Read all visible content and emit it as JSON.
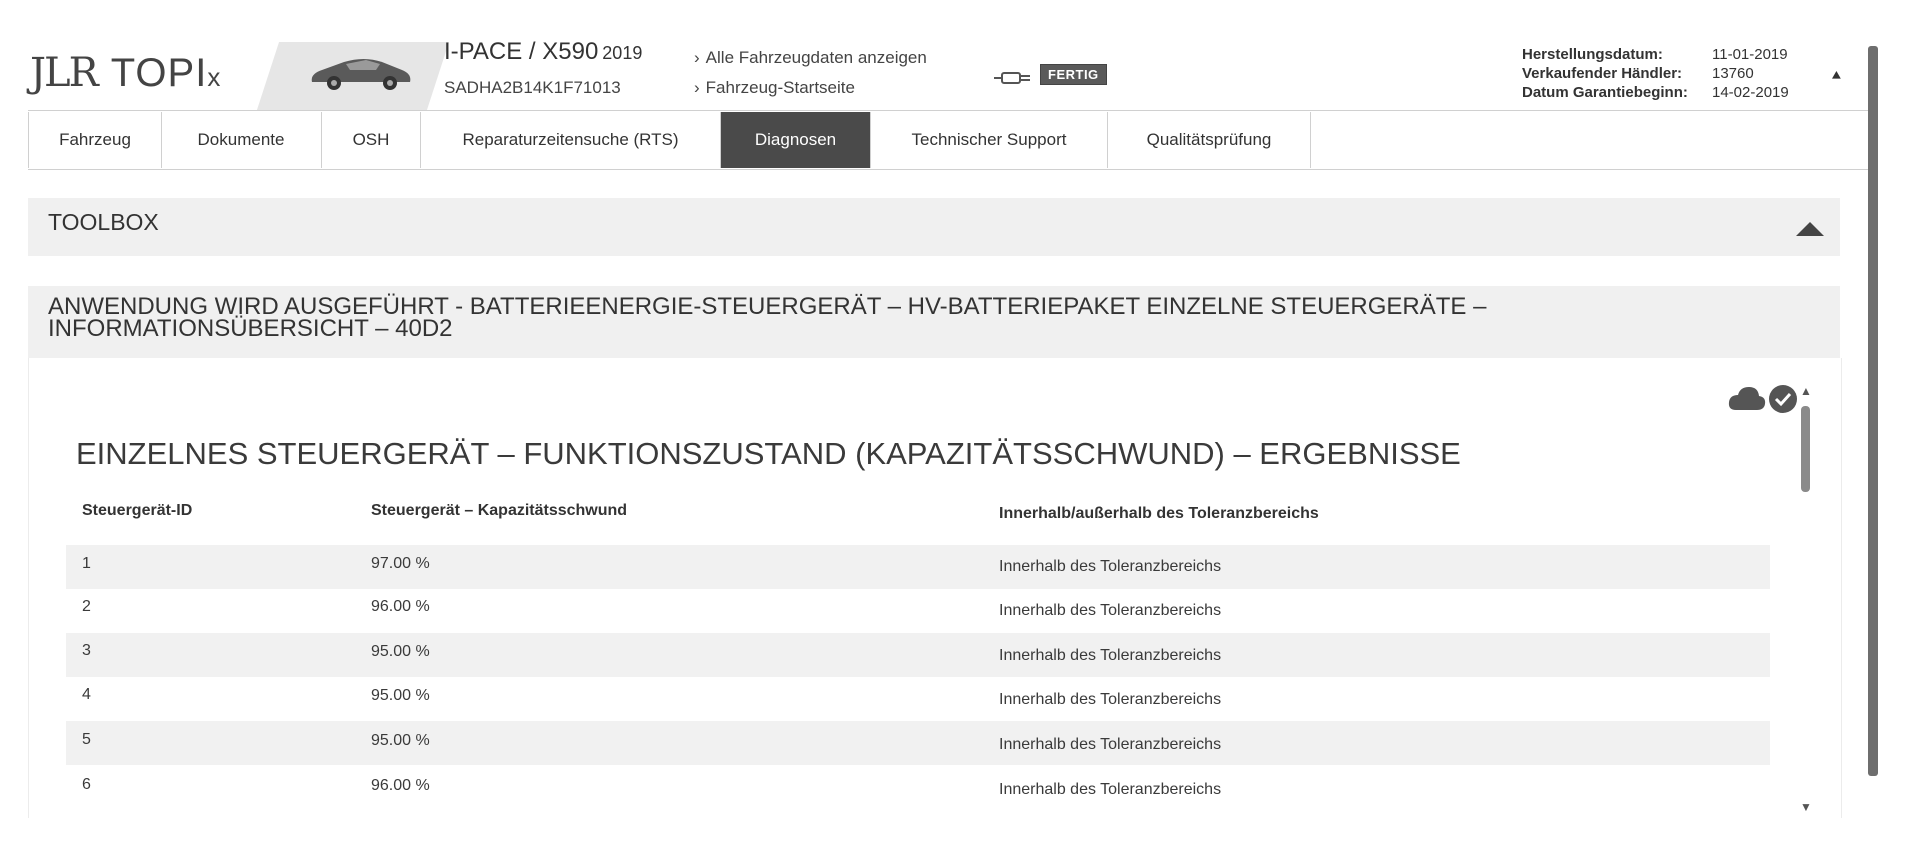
{
  "header": {
    "logo_jlr": "JLR",
    "logo_topix": "TOPI",
    "logo_x": "x",
    "vehicle_model": "I-PACE / X590",
    "vehicle_year": "2019",
    "vin": "SADHA2B14K1F71013",
    "links": [
      "Alle Fahrzeugdaten anzeigen",
      "Fahrzeug-Startseite"
    ],
    "status_badge": "FERTIG",
    "info": [
      {
        "label": "Herstellungsdatum:",
        "value": "11-01-2019"
      },
      {
        "label": "Verkaufender Händler:",
        "value": "13760"
      },
      {
        "label": "Datum Garantiebeginn:",
        "value": "14-02-2019"
      }
    ]
  },
  "tabs": [
    {
      "label": "Fahrzeug",
      "active": false
    },
    {
      "label": "Dokumente",
      "active": false
    },
    {
      "label": "OSH",
      "active": false
    },
    {
      "label": "Reparaturzeitensuche (RTS)",
      "active": false
    },
    {
      "label": "Diagnosen",
      "active": true
    },
    {
      "label": "Technischer Support",
      "active": false
    },
    {
      "label": "Qualitätsprüfung",
      "active": false
    }
  ],
  "toolbox": {
    "title": "TOOLBOX"
  },
  "application": {
    "title": "ANWENDUNG WIRD AUSGEFÜHRT - BATTERIEENERGIE-STEUERGERÄT – HV-BATTERIEPAKET EINZELNE STEUERGERÄTE – INFORMATIONSÜBERSICHT – 40D2"
  },
  "results": {
    "title": "EINZELNES STEUERGERÄT – FUNKTIONSZUSTAND (KAPAZITÄTSSCHWUND) – ERGEBNISSE",
    "columns": [
      "Steuergerät-ID",
      "Steuergerät – Kapazitätsschwund",
      "Innerhalb/außerhalb des Toleranzbereichs"
    ],
    "rows": [
      {
        "id": "1",
        "capacity": "97.00 %",
        "tolerance": "Innerhalb des Toleranzbereichs"
      },
      {
        "id": "2",
        "capacity": "96.00 %",
        "tolerance": "Innerhalb des Toleranzbereichs"
      },
      {
        "id": "3",
        "capacity": "95.00 %",
        "tolerance": "Innerhalb des Toleranzbereichs"
      },
      {
        "id": "4",
        "capacity": "95.00 %",
        "tolerance": "Innerhalb des Toleranzbereichs"
      },
      {
        "id": "5",
        "capacity": "95.00 %",
        "tolerance": "Innerhalb des Toleranzbereichs"
      },
      {
        "id": "6",
        "capacity": "96.00 %",
        "tolerance": "Innerhalb des Toleranzbereichs"
      }
    ]
  },
  "icons": {
    "car": "car-icon",
    "plug": "plug-icon",
    "cloud": "cloud-icon",
    "check": "check-circle-icon",
    "collapse": "double-chevron-up-icon"
  },
  "colors": {
    "active_tab": "#4a4a4a",
    "band": "#f0f0f0",
    "row_shade": "#f1f1f1"
  }
}
